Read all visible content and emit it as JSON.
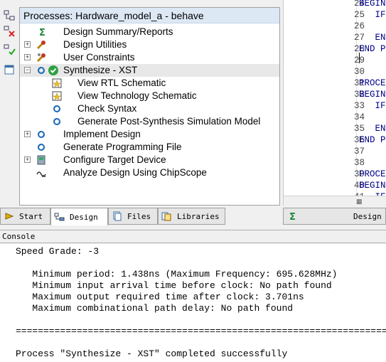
{
  "processes": {
    "header": "Processes: Hardware_model_a - behave",
    "items": [
      {
        "label": "Design Summary/Reports",
        "icon": "sigma-icon"
      },
      {
        "label": "Design Utilities",
        "icon": "tools-icon"
      },
      {
        "label": "User Constraints",
        "icon": "constraints-icon"
      },
      {
        "label": "Synthesize - XST",
        "icon": "check-icon"
      },
      {
        "label": "View RTL Schematic",
        "icon": "rtl-schematic-icon"
      },
      {
        "label": "View Technology Schematic",
        "icon": "tech-schematic-icon"
      },
      {
        "label": "Check Syntax",
        "icon": "run-icon"
      },
      {
        "label": "Generate Post-Synthesis Simulation Model",
        "icon": "run-icon"
      },
      {
        "label": "Implement Design",
        "icon": "run-icon"
      },
      {
        "label": "Generate Programming File",
        "icon": "run-icon"
      },
      {
        "label": "Configure Target Device",
        "icon": "device-icon"
      },
      {
        "label": "Analyze Design Using ChipScope",
        "icon": "chipscope-icon"
      }
    ]
  },
  "code": {
    "line_numbers": [
      "24",
      "25",
      "26",
      "27",
      "28",
      "29",
      "30",
      "31",
      "32",
      "33",
      "34",
      "35",
      "36",
      "37",
      "38",
      "39",
      "40",
      "41"
    ],
    "lines": [
      "BEGIN",
      "   IF",
      "",
      "   EN",
      "END P",
      "",
      "",
      "PROCE",
      "BEGIN",
      "   IF",
      "",
      "   EN",
      "END P",
      "",
      "",
      "PROCE",
      "BEGIN",
      "   IF"
    ]
  },
  "tabs": {
    "start": "Start",
    "design": "Design",
    "files": "Files",
    "libraries": "Libraries",
    "right_design": "Design"
  },
  "console": {
    "title": "Console",
    "lines": [
      "Speed Grade: -3",
      "",
      "   Minimum period: 1.438ns (Maximum Frequency: 695.628MHz)",
      "   Minimum input arrival time before clock: No path found",
      "   Maximum output required time after clock: 3.701ns",
      "   Maximum combinational path delay: No path found",
      "",
      "=========================================================================",
      "",
      "Process \"Synthesize - XST\" completed successfully"
    ]
  },
  "colors": {
    "header_bg": "#dde8f5",
    "code_keyword": "#00008b",
    "success_green": "#2ea043"
  }
}
